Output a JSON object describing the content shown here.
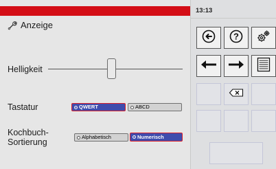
{
  "header": {
    "title": "Anzeige",
    "title_icon": "wrench-icon",
    "accent_color": "#d40e16"
  },
  "brightness": {
    "label": "Helligkeit"
  },
  "keyboard": {
    "label": "Tastatur",
    "options": [
      {
        "label": "QWERT",
        "selected": true
      },
      {
        "label": "ABCD",
        "selected": false
      }
    ]
  },
  "cookbook_sort": {
    "label_line1": "Kochbuch-",
    "label_line2": "Sortierung",
    "options": [
      {
        "label": "Alphabetisch",
        "selected": false
      },
      {
        "label": "Numerisch",
        "selected": true
      }
    ]
  },
  "sidepanel": {
    "clock": "13:13",
    "buttons": [
      "back-circle-icon",
      "help-icon",
      "settings-gears-icon",
      "arrow-left-icon",
      "arrow-right-icon",
      "list-view-icon",
      "backspace-icon"
    ]
  }
}
